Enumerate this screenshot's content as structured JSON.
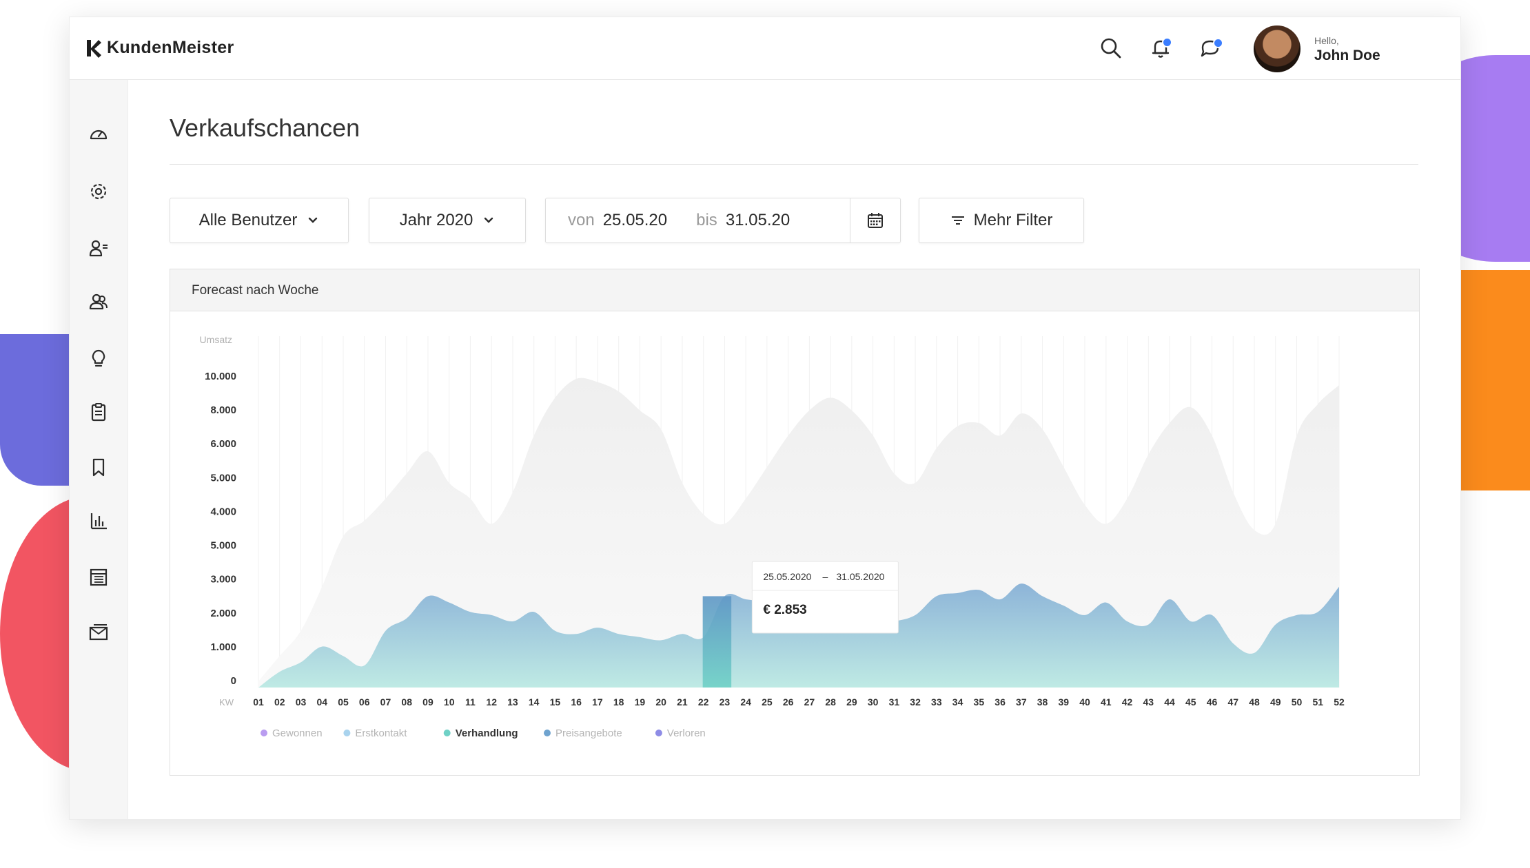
{
  "app": {
    "brand": "KundenMeister"
  },
  "user": {
    "greeting": "Hello,",
    "name": "John Doe"
  },
  "page": {
    "title": "Verkaufschancen"
  },
  "filters": {
    "users": "Alle Benutzer",
    "year": "Jahr 2020",
    "from_label": "von",
    "from_value": "25.05.20",
    "to_label": "bis",
    "to_value": "31.05.20",
    "more": "Mehr Filter"
  },
  "icons": {
    "top": [
      "search-icon",
      "bell-icon",
      "chat-icon"
    ],
    "sidebar": [
      "dashboard-icon",
      "gear-icon",
      "contacts-icon",
      "users-icon",
      "lightbulb-icon",
      "clipboard-icon",
      "bookmark-icon",
      "bar-chart-icon",
      "table-icon",
      "mail-icon"
    ]
  },
  "colors": {
    "notification": "#3a7dff",
    "accent_teal": "#6fd1c6",
    "accent_blue": "#6fa3cf"
  },
  "chart_data": {
    "type": "area",
    "title": "Forecast nach Woche",
    "ylabel": "Umsatz",
    "xlabel": "KW",
    "y_ticks": [
      "10.000",
      "8.000",
      "6.000",
      "5.000",
      "4.000",
      "5.000",
      "3.000",
      "2.000",
      "1.000",
      "0"
    ],
    "categories": [
      "01",
      "02",
      "03",
      "04",
      "05",
      "06",
      "07",
      "08",
      "09",
      "10",
      "11",
      "12",
      "13",
      "14",
      "15",
      "16",
      "17",
      "18",
      "19",
      "20",
      "21",
      "22",
      "23",
      "24",
      "25",
      "26",
      "27",
      "28",
      "29",
      "30",
      "31",
      "32",
      "33",
      "34",
      "35",
      "36",
      "37",
      "38",
      "39",
      "40",
      "41",
      "42",
      "43",
      "44",
      "45",
      "46",
      "47",
      "48",
      "49",
      "50",
      "51",
      "52"
    ],
    "series": [
      {
        "values": [
          200,
          1000,
          1800,
          3200,
          4800,
          5300,
          6000,
          6800,
          7500,
          6500,
          6000,
          5200,
          6200,
          8000,
          9200,
          9800,
          9700,
          9400,
          8800,
          8200,
          6500,
          5500,
          5200,
          6000,
          7000,
          8000,
          8800,
          9200,
          8800,
          8000,
          6800,
          6500,
          7600,
          8300,
          8400,
          8000,
          8700,
          8200,
          7000,
          5800,
          5200,
          6000,
          7400,
          8400,
          8900,
          8000,
          6200,
          5000,
          5200,
          8000,
          9000,
          9600
        ]
      },
      {
        "values": [
          0,
          500,
          800,
          1300,
          1000,
          700,
          1800,
          2200,
          2900,
          2700,
          2400,
          2300,
          2100,
          2400,
          1800,
          1700,
          1900,
          1700,
          1600,
          1500,
          1700,
          1600,
          2900,
          2800,
          2700,
          2500,
          2100,
          1900,
          1900,
          2000,
          2100,
          2300,
          2900,
          3000,
          3100,
          2800,
          3300,
          2900,
          2600,
          2300,
          2700,
          2100,
          2000,
          2800,
          2100,
          2300,
          1400,
          1100,
          2000,
          2300,
          2400,
          3200
        ]
      }
    ],
    "highlight": {
      "category": "22",
      "range_from": "25.05.2020",
      "range_sep": "–",
      "range_to": "31.05.2020",
      "value_label": "€ 2.853"
    },
    "legend": [
      "Gewonnen",
      "Erstkontakt",
      "Verhandlung",
      "Preisangebote",
      "Verloren"
    ],
    "legend_colors": [
      "#b99cf0",
      "#a9d3ee",
      "#6fd1c6",
      "#6fa3cf",
      "#8e8ce6"
    ],
    "legend_active": "Verhandlung",
    "legend_position": "bottom-left",
    "grid": true
  }
}
